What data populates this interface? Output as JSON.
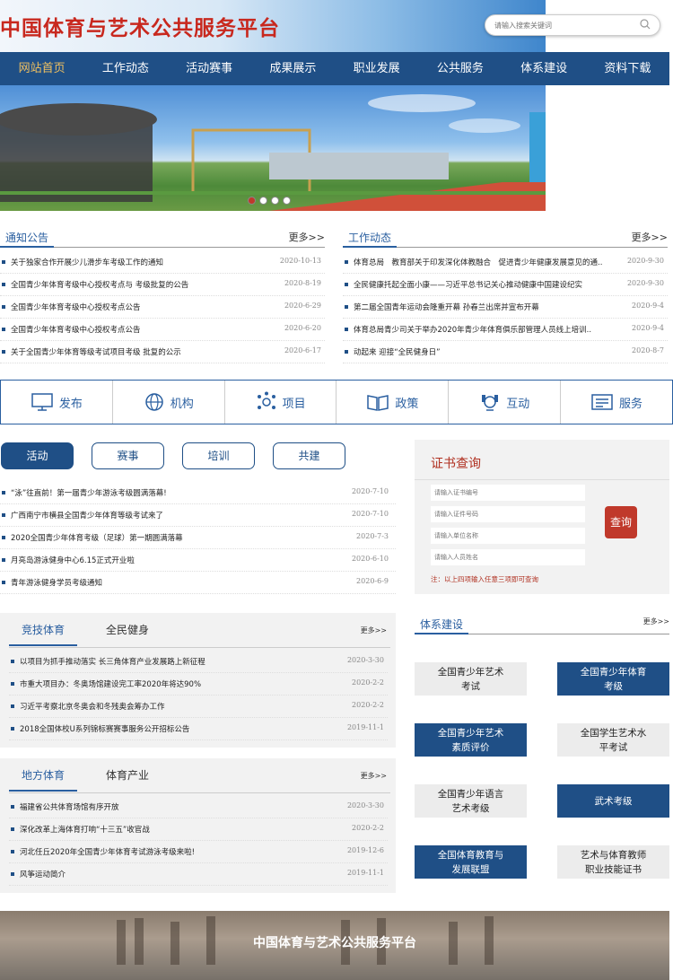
{
  "header": {
    "title": "中国体育与艺术公共服务平台",
    "search_placeholder": "请输入搜索关键词"
  },
  "nav": [
    "网站首页",
    "工作动态",
    "活动赛事",
    "成果展示",
    "职业发展",
    "公共服务",
    "体系建设",
    "资料下载"
  ],
  "notice": {
    "title": "通知公告",
    "more": "更多>>",
    "items": [
      {
        "t": "关于独家合作开展少儿滑步车考级工作的通知",
        "d": "2020-10-13"
      },
      {
        "t": "全国青少年体育考级中心授权考点与 考级批复的公告",
        "d": "2020-8-19"
      },
      {
        "t": "全国青少年体育考级中心授权考点公告",
        "d": "2020-6-29"
      },
      {
        "t": "全国青少年体育考级中心授权考点公告",
        "d": "2020-6-20"
      },
      {
        "t": "关于全国青少年体育等级考试项目考级 批复的公示",
        "d": "2020-6-17"
      }
    ]
  },
  "work": {
    "title": "工作动态",
    "more": "更多>>",
    "items": [
      {
        "t": "体育总局　教育部关于印发深化体教融合　促进青少年健康发展意见的通..",
        "d": "2020-9-30"
      },
      {
        "t": "全民健康托起全面小康——习近平总书记关心推动健康中国建设纪实",
        "d": "2020-9-30"
      },
      {
        "t": "第二届全国青年运动会隆重开幕 孙春兰出席并宣布开幕",
        "d": "2020-9-4"
      },
      {
        "t": "体育总局青少司关于举办2020年青少年体育俱乐部管理人员线上培训..",
        "d": "2020-9-4"
      },
      {
        "t": "动起来 迎接“全民健身日”",
        "d": "2020-8-7"
      }
    ]
  },
  "services": [
    "发布",
    "机构",
    "项目",
    "政策",
    "互动",
    "服务"
  ],
  "pills": [
    "活动",
    "赛事",
    "培训",
    "共建"
  ],
  "activity": [
    {
      "t": "“泳”往直前！第一届青少年游泳考级圆满落幕!",
      "d": "2020-7-10"
    },
    {
      "t": "广西南宁市横县全国青少年体育等级考试来了",
      "d": "2020-7-10"
    },
    {
      "t": "2020全国青少年体育考级（足球）第一期圆满落幕",
      "d": "2020-7-3"
    },
    {
      "t": "月亮岛游泳健身中心6.15正式开业啦",
      "d": "2020-6-10"
    },
    {
      "t": "青年游泳健身学员考级通知",
      "d": "2020-6-9"
    }
  ],
  "cert": {
    "title": "证书查询",
    "fields": [
      "请输入证书编号",
      "请输入证件号码",
      "请输入单位名称",
      "请输入人员姓名"
    ],
    "button": "查询",
    "note": "注：以上四项输入任意三项即可查询"
  },
  "competitive": {
    "tabs": [
      "竞技体育",
      "全民健身"
    ],
    "more": "更多>>",
    "items": [
      {
        "t": "以项目为抓手推动落实 长三角体育产业发展路上新征程",
        "d": "2020-3-30"
      },
      {
        "t": "市重大项目办：冬奥场馆建设完工率2020年将达90%",
        "d": "2020-2-2"
      },
      {
        "t": "习近平考察北京冬奥会和冬残奥会筹办工作",
        "d": "2020-2-2"
      },
      {
        "t": "2018全国体校U系列锦标赛赛事服务公开招标公告",
        "d": "2019-11-1"
      }
    ]
  },
  "local": {
    "tabs": [
      "地方体育",
      "体育产业"
    ],
    "more": "更多>>",
    "items": [
      {
        "t": "福建省公共体育场馆有序开放",
        "d": "2020-3-30"
      },
      {
        "t": "深化改革上海体育打响“十三五”收官战",
        "d": "2020-2-2"
      },
      {
        "t": "河北任丘2020年全国青少年体育考试游泳考级来啦!",
        "d": "2019-12-6"
      },
      {
        "t": "风筝运动简介",
        "d": "2019-11-1"
      }
    ]
  },
  "system": {
    "title": "体系建设",
    "more": "更多>>",
    "items": [
      {
        "l1": "全国青少年艺术",
        "l2": "考试",
        "style": "grey"
      },
      {
        "l1": "全国青少年体育",
        "l2": "考级",
        "style": "blue"
      },
      {
        "l1": "全国青少年艺术",
        "l2": "素质评价",
        "style": "blue"
      },
      {
        "l1": "全国学生艺术水",
        "l2": "平考试",
        "style": "grey"
      },
      {
        "l1": "全国青少年语言",
        "l2": "艺术考级",
        "style": "grey"
      },
      {
        "l1": "武术考级",
        "l2": "",
        "style": "blue"
      },
      {
        "l1": "全国体育教育与",
        "l2": "发展联盟",
        "style": "blue"
      },
      {
        "l1": "艺术与体育教师",
        "l2": "职业技能证书",
        "style": "grey"
      }
    ]
  },
  "footer": {
    "title": "中国体育与艺术公共服务平台"
  }
}
